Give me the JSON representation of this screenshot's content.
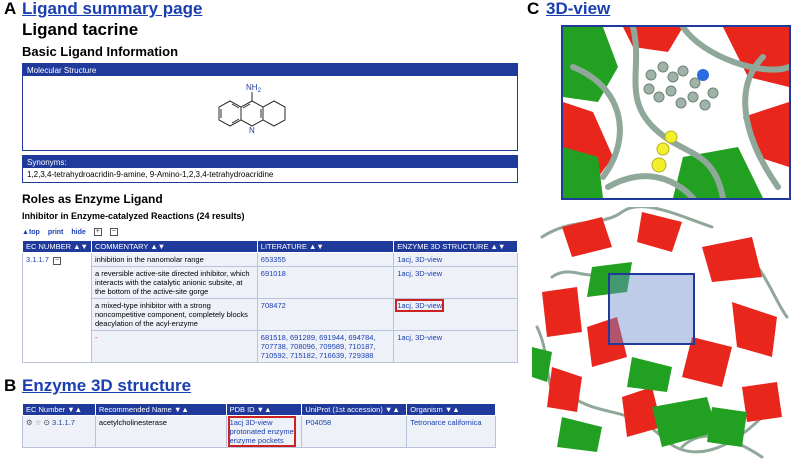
{
  "panels": {
    "a": {
      "letter": "A",
      "title": "Ligand summary page"
    },
    "b": {
      "letter": "B",
      "title": "Enzyme 3D structure"
    },
    "c": {
      "letter": "C",
      "title": "3D-view"
    }
  },
  "ligand": {
    "heading": "Ligand tacrine",
    "basic_heading": "Basic Ligand Information",
    "structure_label": "Molecular Structure",
    "nh2_label": "NH",
    "nh2_sub": "2",
    "n_label": "N",
    "synonyms_label": "Synonyms:",
    "synonyms": "1,2,3,4-tetrahydroacridin-9-amine, 9-Amino-1,2,3,4-tetrahydroacridine"
  },
  "roles": {
    "heading": "Roles as Enzyme Ligand",
    "subheading": "Inhibitor in Enzyme-catalyzed Reactions (24 results)",
    "toolbar": {
      "top": "top",
      "print": "print",
      "hide": "hide",
      "plus": "+",
      "minus": "−"
    },
    "columns": [
      "EC NUMBER ▲▼",
      "COMMENTARY ▲▼",
      "LITERATURE ▲▼",
      "ENZYME 3D STRUCTURE ▲▼"
    ],
    "ec": "3.1.1.7",
    "rows": [
      {
        "commentary": "inhibition in the nanomolar range",
        "literature": "653355",
        "structure": "1acj, 3D-view"
      },
      {
        "commentary": "a reversible active-site directed inhibitor, which interacts with the catalytic anionic subsite, at the bottom of the active-site gorge",
        "literature": "691018",
        "structure": "1acj, 3D-view"
      },
      {
        "commentary": "a mixed-type inhibitor with a strong noncompetitive component, completely blocks deacylation of the acyl-enzyme",
        "literature": "708472",
        "structure": "1acj, 3D-view"
      },
      {
        "commentary": "-",
        "literature": "681518, 691289, 691944, 694784, 707738, 708096, 709589, 710187, 710592, 715182, 716639, 729388",
        "structure": "1acj, 3D-view"
      }
    ]
  },
  "enzyme3d": {
    "columns": [
      "EC Number ▼▲",
      "Recommended Name ▼▲",
      "PDB ID ▼▲",
      "UniProt (1st accession) ▼▲",
      "Organism ▼▲"
    ],
    "row": {
      "ec": "3.1.1.7",
      "name": "acetylcholinesterase",
      "pdb_1": "1acj 3D-view",
      "pdb_2": "protonated enzyme",
      "pdb_3": "enzyme pockets",
      "uniprot": "P04058",
      "organism": "Tetronarce californica"
    }
  },
  "colors": {
    "header_blue": "#1f3a9a",
    "link_blue": "#1a3fb0",
    "highlight_red": "#cc2222",
    "protein_red": "#e8261c",
    "protein_green": "#22a022"
  }
}
